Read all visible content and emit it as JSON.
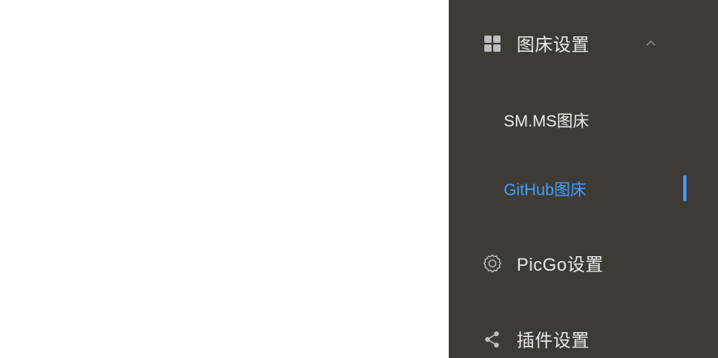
{
  "sidebar": {
    "picbed_group": {
      "label": "图床设置",
      "icon": "grid-icon",
      "expanded": true,
      "chevron": "chevron-up-icon"
    },
    "sub_items": [
      {
        "label": "SM.MS图床",
        "active": false
      },
      {
        "label": "GitHub图床",
        "active": true
      }
    ],
    "picgo_settings": {
      "label": "PicGo设置",
      "icon": "gear-icon"
    },
    "plugin_settings": {
      "label": "插件设置",
      "icon": "share-icon"
    }
  },
  "colors": {
    "sidebar_bg": "#3e3b36",
    "text": "#e9e9e9",
    "icon": "#bdbdbd",
    "active": "#409eff",
    "content_bg": "#ffffff"
  }
}
